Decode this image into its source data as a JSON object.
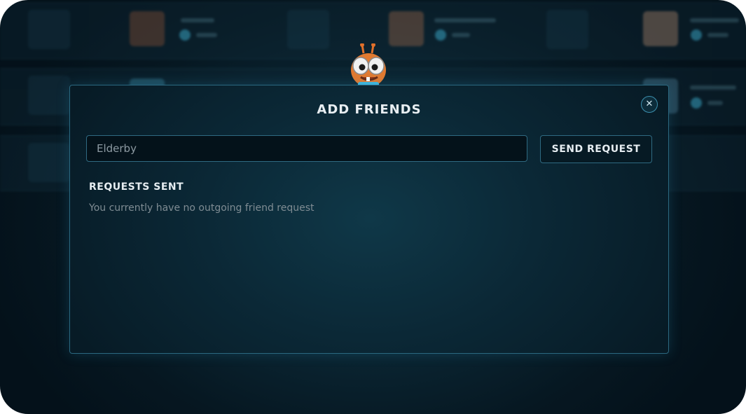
{
  "modal": {
    "title": "ADD FRIENDS",
    "close_icon": "close-icon",
    "search": {
      "value": "Elderby",
      "placeholder": ""
    },
    "send_button_label": "SEND REQUEST",
    "requests_sent_title": "REQUESTS SENT",
    "empty_message": "You currently have no outgoing friend request"
  },
  "colors": {
    "accent": "#3c8fae",
    "modal_border": "#2b6880",
    "text_primary": "#e6edf1",
    "text_muted": "#7f8c93"
  },
  "icons": [
    "close-icon",
    "mascot-icon"
  ]
}
